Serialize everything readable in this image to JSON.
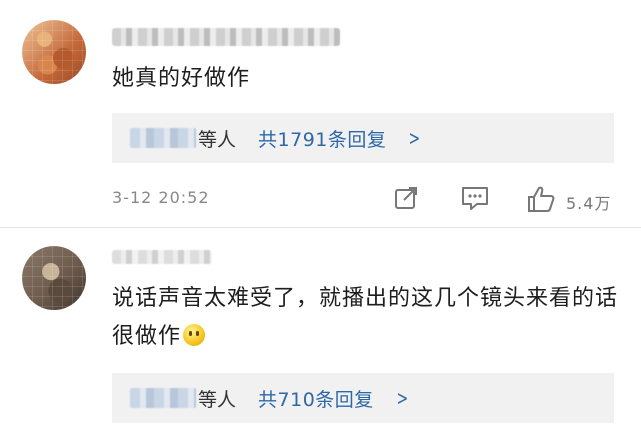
{
  "comments": [
    {
      "text": "她真的好做作",
      "reply_suffix": "等人",
      "reply_count": "共1791条回复",
      "timestamp": "3-12 20:52",
      "likes": "5.4万",
      "icons": [
        "share-icon",
        "comment-icon",
        "like-icon"
      ]
    },
    {
      "text": "说话声音太难受了，就播出的这几个镜头来看的话很做作",
      "emoji": "smile-emoji",
      "reply_suffix": "等人",
      "reply_count": "共710条回复"
    }
  ],
  "colors": {
    "link": "#2e68a8",
    "reply_bg": "#f1f1f1",
    "meta": "#888888"
  }
}
